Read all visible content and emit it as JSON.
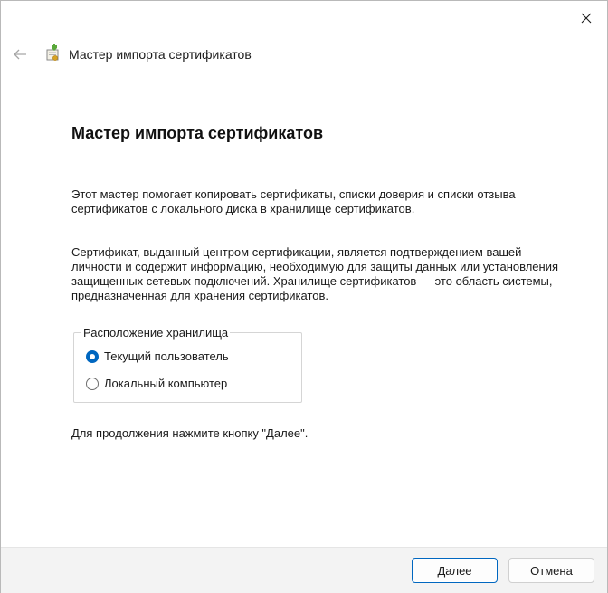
{
  "window": {
    "title": "Мастер импорта сертификатов",
    "close_icon": "close-icon",
    "back_icon": "back-arrow-icon",
    "app_icon": "certificate-wizard-icon"
  },
  "content": {
    "heading": "Мастер импорта сертификатов",
    "paragraph1": "Этот мастер помогает копировать сертификаты, списки доверия и списки отзыва сертификатов с локального диска в хранилище сертификатов.",
    "paragraph2": "Сертификат, выданный центром сертификации, является подтверждением вашей личности и содержит информацию, необходимую для защиты данных или установления защищенных сетевых подключений. Хранилище сертификатов — это область системы, предназначенная для хранения сертификатов.",
    "store_location": {
      "legend": "Расположение хранилища",
      "options": [
        {
          "label": "Текущий пользователь",
          "selected": true
        },
        {
          "label": "Локальный компьютер",
          "selected": false
        }
      ]
    },
    "hint": "Для продолжения нажмите кнопку \"Далее\"."
  },
  "footer": {
    "next_label": "Далее",
    "cancel_label": "Отмена"
  },
  "colors": {
    "accent": "#0067c0",
    "footer_bg": "#f3f3f3"
  }
}
